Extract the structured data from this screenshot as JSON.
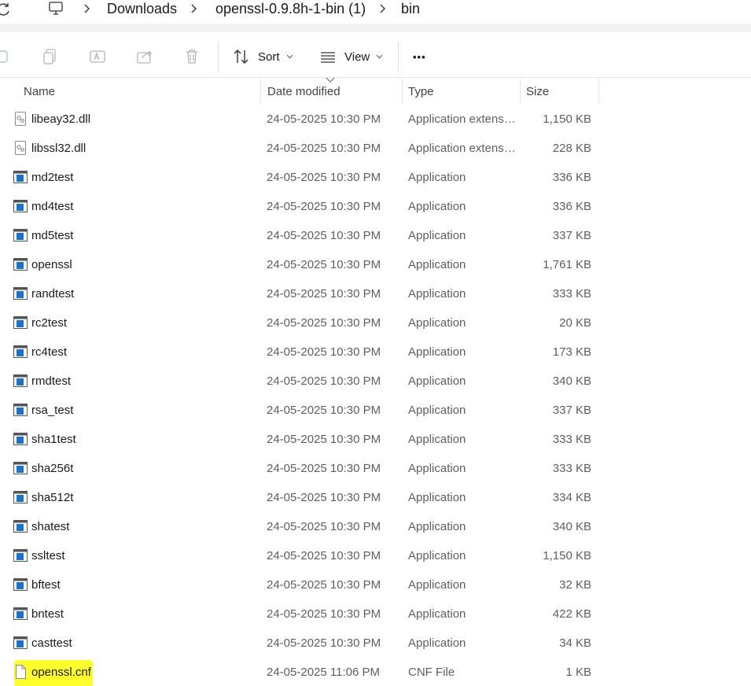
{
  "address": {
    "crumbs": [
      "Downloads",
      "openssl-0.9.8h-1-bin (1)",
      "bin"
    ]
  },
  "toolbar": {
    "sort_label": "Sort",
    "view_label": "View",
    "more_label": "•••"
  },
  "columns": {
    "name": "Name",
    "date": "Date modified",
    "type": "Type",
    "size": "Size"
  },
  "files": [
    {
      "name": "libeay32.dll",
      "date": "24-05-2025 10:30 PM",
      "type": "Application extension",
      "size": "1,150 KB",
      "icon": "dll-icon"
    },
    {
      "name": "libssl32.dll",
      "date": "24-05-2025 10:30 PM",
      "type": "Application extension",
      "size": "228 KB",
      "icon": "dll-icon"
    },
    {
      "name": "md2test",
      "date": "24-05-2025 10:30 PM",
      "type": "Application",
      "size": "336 KB",
      "icon": "exe-icon"
    },
    {
      "name": "md4test",
      "date": "24-05-2025 10:30 PM",
      "type": "Application",
      "size": "336 KB",
      "icon": "exe-icon"
    },
    {
      "name": "md5test",
      "date": "24-05-2025 10:30 PM",
      "type": "Application",
      "size": "337 KB",
      "icon": "exe-icon"
    },
    {
      "name": "openssl",
      "date": "24-05-2025 10:30 PM",
      "type": "Application",
      "size": "1,761 KB",
      "icon": "exe-icon"
    },
    {
      "name": "randtest",
      "date": "24-05-2025 10:30 PM",
      "type": "Application",
      "size": "333 KB",
      "icon": "exe-icon"
    },
    {
      "name": "rc2test",
      "date": "24-05-2025 10:30 PM",
      "type": "Application",
      "size": "20 KB",
      "icon": "exe-icon"
    },
    {
      "name": "rc4test",
      "date": "24-05-2025 10:30 PM",
      "type": "Application",
      "size": "173 KB",
      "icon": "exe-icon"
    },
    {
      "name": "rmdtest",
      "date": "24-05-2025 10:30 PM",
      "type": "Application",
      "size": "340 KB",
      "icon": "exe-icon"
    },
    {
      "name": "rsa_test",
      "date": "24-05-2025 10:30 PM",
      "type": "Application",
      "size": "337 KB",
      "icon": "exe-icon"
    },
    {
      "name": "sha1test",
      "date": "24-05-2025 10:30 PM",
      "type": "Application",
      "size": "333 KB",
      "icon": "exe-icon"
    },
    {
      "name": "sha256t",
      "date": "24-05-2025 10:30 PM",
      "type": "Application",
      "size": "333 KB",
      "icon": "exe-icon"
    },
    {
      "name": "sha512t",
      "date": "24-05-2025 10:30 PM",
      "type": "Application",
      "size": "334 KB",
      "icon": "exe-icon"
    },
    {
      "name": "shatest",
      "date": "24-05-2025 10:30 PM",
      "type": "Application",
      "size": "340 KB",
      "icon": "exe-icon"
    },
    {
      "name": "ssltest",
      "date": "24-05-2025 10:30 PM",
      "type": "Application",
      "size": "1,150 KB",
      "icon": "exe-icon"
    },
    {
      "name": "bftest",
      "date": "24-05-2025 10:30 PM",
      "type": "Application",
      "size": "32 KB",
      "icon": "exe-icon"
    },
    {
      "name": "bntest",
      "date": "24-05-2025 10:30 PM",
      "type": "Application",
      "size": "422 KB",
      "icon": "exe-icon"
    },
    {
      "name": "casttest",
      "date": "24-05-2025 10:30 PM",
      "type": "Application",
      "size": "34 KB",
      "icon": "exe-icon"
    },
    {
      "name": "openssl.cnf",
      "date": "24-05-2025 11:06 PM",
      "type": "CNF File",
      "size": "1 KB",
      "icon": "file-icon",
      "highlighted": true
    }
  ],
  "colors": {
    "highlight": "#ffff2e",
    "exe_blue": "#1a73c8"
  }
}
